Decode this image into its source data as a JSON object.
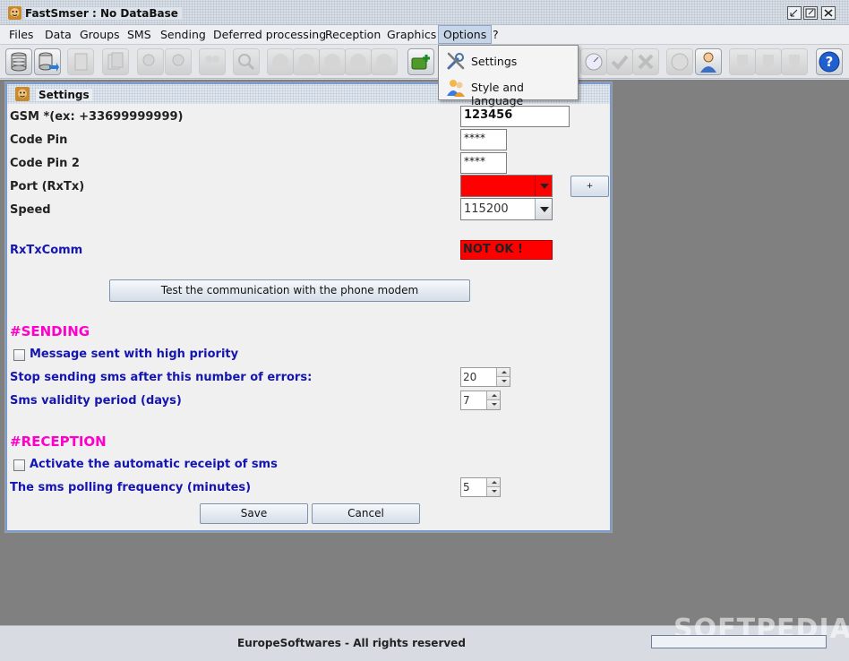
{
  "window": {
    "title": "FastSmser : No DataBase",
    "icon": "app-face-icon"
  },
  "menubar": {
    "items": [
      "Files",
      "Data",
      "Groups",
      "SMS",
      "Sending",
      "Deferred processing",
      "Reception",
      "Graphics",
      "Options",
      "?"
    ],
    "open_item": "Options"
  },
  "options_menu": {
    "items": [
      {
        "label": "Settings",
        "icon": "tools-icon"
      },
      {
        "label": "Style and language",
        "icon": "people-icon"
      }
    ]
  },
  "settings": {
    "title": "Settings",
    "gsm_label": "GSM  *(ex: +33699999999)",
    "gsm_value": "123456",
    "pin_label": "Code Pin",
    "pin_value": "****",
    "pin2_label": "Code Pin 2",
    "pin2_value": "****",
    "port_label": "Port (RxTx)",
    "port_value": "",
    "port_add_label": "+",
    "speed_label": "Speed",
    "speed_value": "115200",
    "rxtx_label": "RxTxComm",
    "rxtx_status": "NOT OK !",
    "test_button": "Test the communication with the phone modem",
    "sending_header": "#SENDING",
    "priority_label": "Message sent with high priority",
    "priority_checked": false,
    "errors_label": "Stop sending sms after this number of errors:",
    "errors_value": "20",
    "validity_label": "Sms validity period (days)",
    "validity_value": "7",
    "reception_header": "#RECEPTION",
    "auto_receipt_label": "Activate the automatic receipt of sms",
    "auto_receipt_checked": false,
    "polling_label": "The sms polling frequency (minutes)",
    "polling_value": "5",
    "save_button": "Save",
    "cancel_button": "Cancel"
  },
  "statusbar": {
    "copyright": "EuropeSoftwares - All rights reserved",
    "watermark": "SOFTPEDIA"
  },
  "colors": {
    "error_red": "#ff0000",
    "section_magenta": "#ff00cc",
    "label_blue": "#1515b0",
    "desktop_gray": "#808080"
  }
}
